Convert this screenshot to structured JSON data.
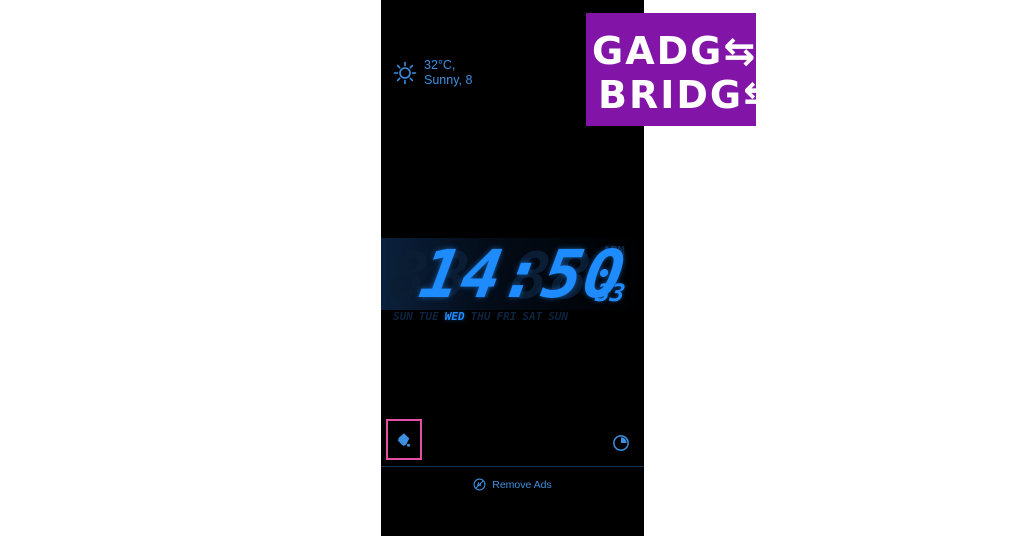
{
  "weather": {
    "temperature": "32°C,",
    "condition": "Sunny, 8",
    "icon": "sun-icon"
  },
  "clock": {
    "time": "14:50",
    "seconds": "33",
    "ghost_time": "88:88",
    "ampm_ghost": "APM",
    "days": [
      {
        "label": "SUN",
        "active": false
      },
      {
        "label": "TUE",
        "active": false
      },
      {
        "label": "WED",
        "active": true
      },
      {
        "label": "THU",
        "active": false
      },
      {
        "label": "FRI",
        "active": false
      },
      {
        "label": "SAT",
        "active": false
      },
      {
        "label": "SUN",
        "active": false
      }
    ]
  },
  "controls": {
    "alarm_icon": "alarm-bell-icon",
    "timer_icon": "timer-icon",
    "remove_ads_label": "Remove Ads",
    "remove_ads_icon": "no-ads-icon"
  },
  "logo": {
    "line1": "GADG⇆T",
    "line2": "BRIDG⇆",
    "color": "#8314a8"
  },
  "colors": {
    "accent": "#1e8cff",
    "text_blue": "#3d8fe0",
    "highlight_border": "#e44fa6"
  }
}
